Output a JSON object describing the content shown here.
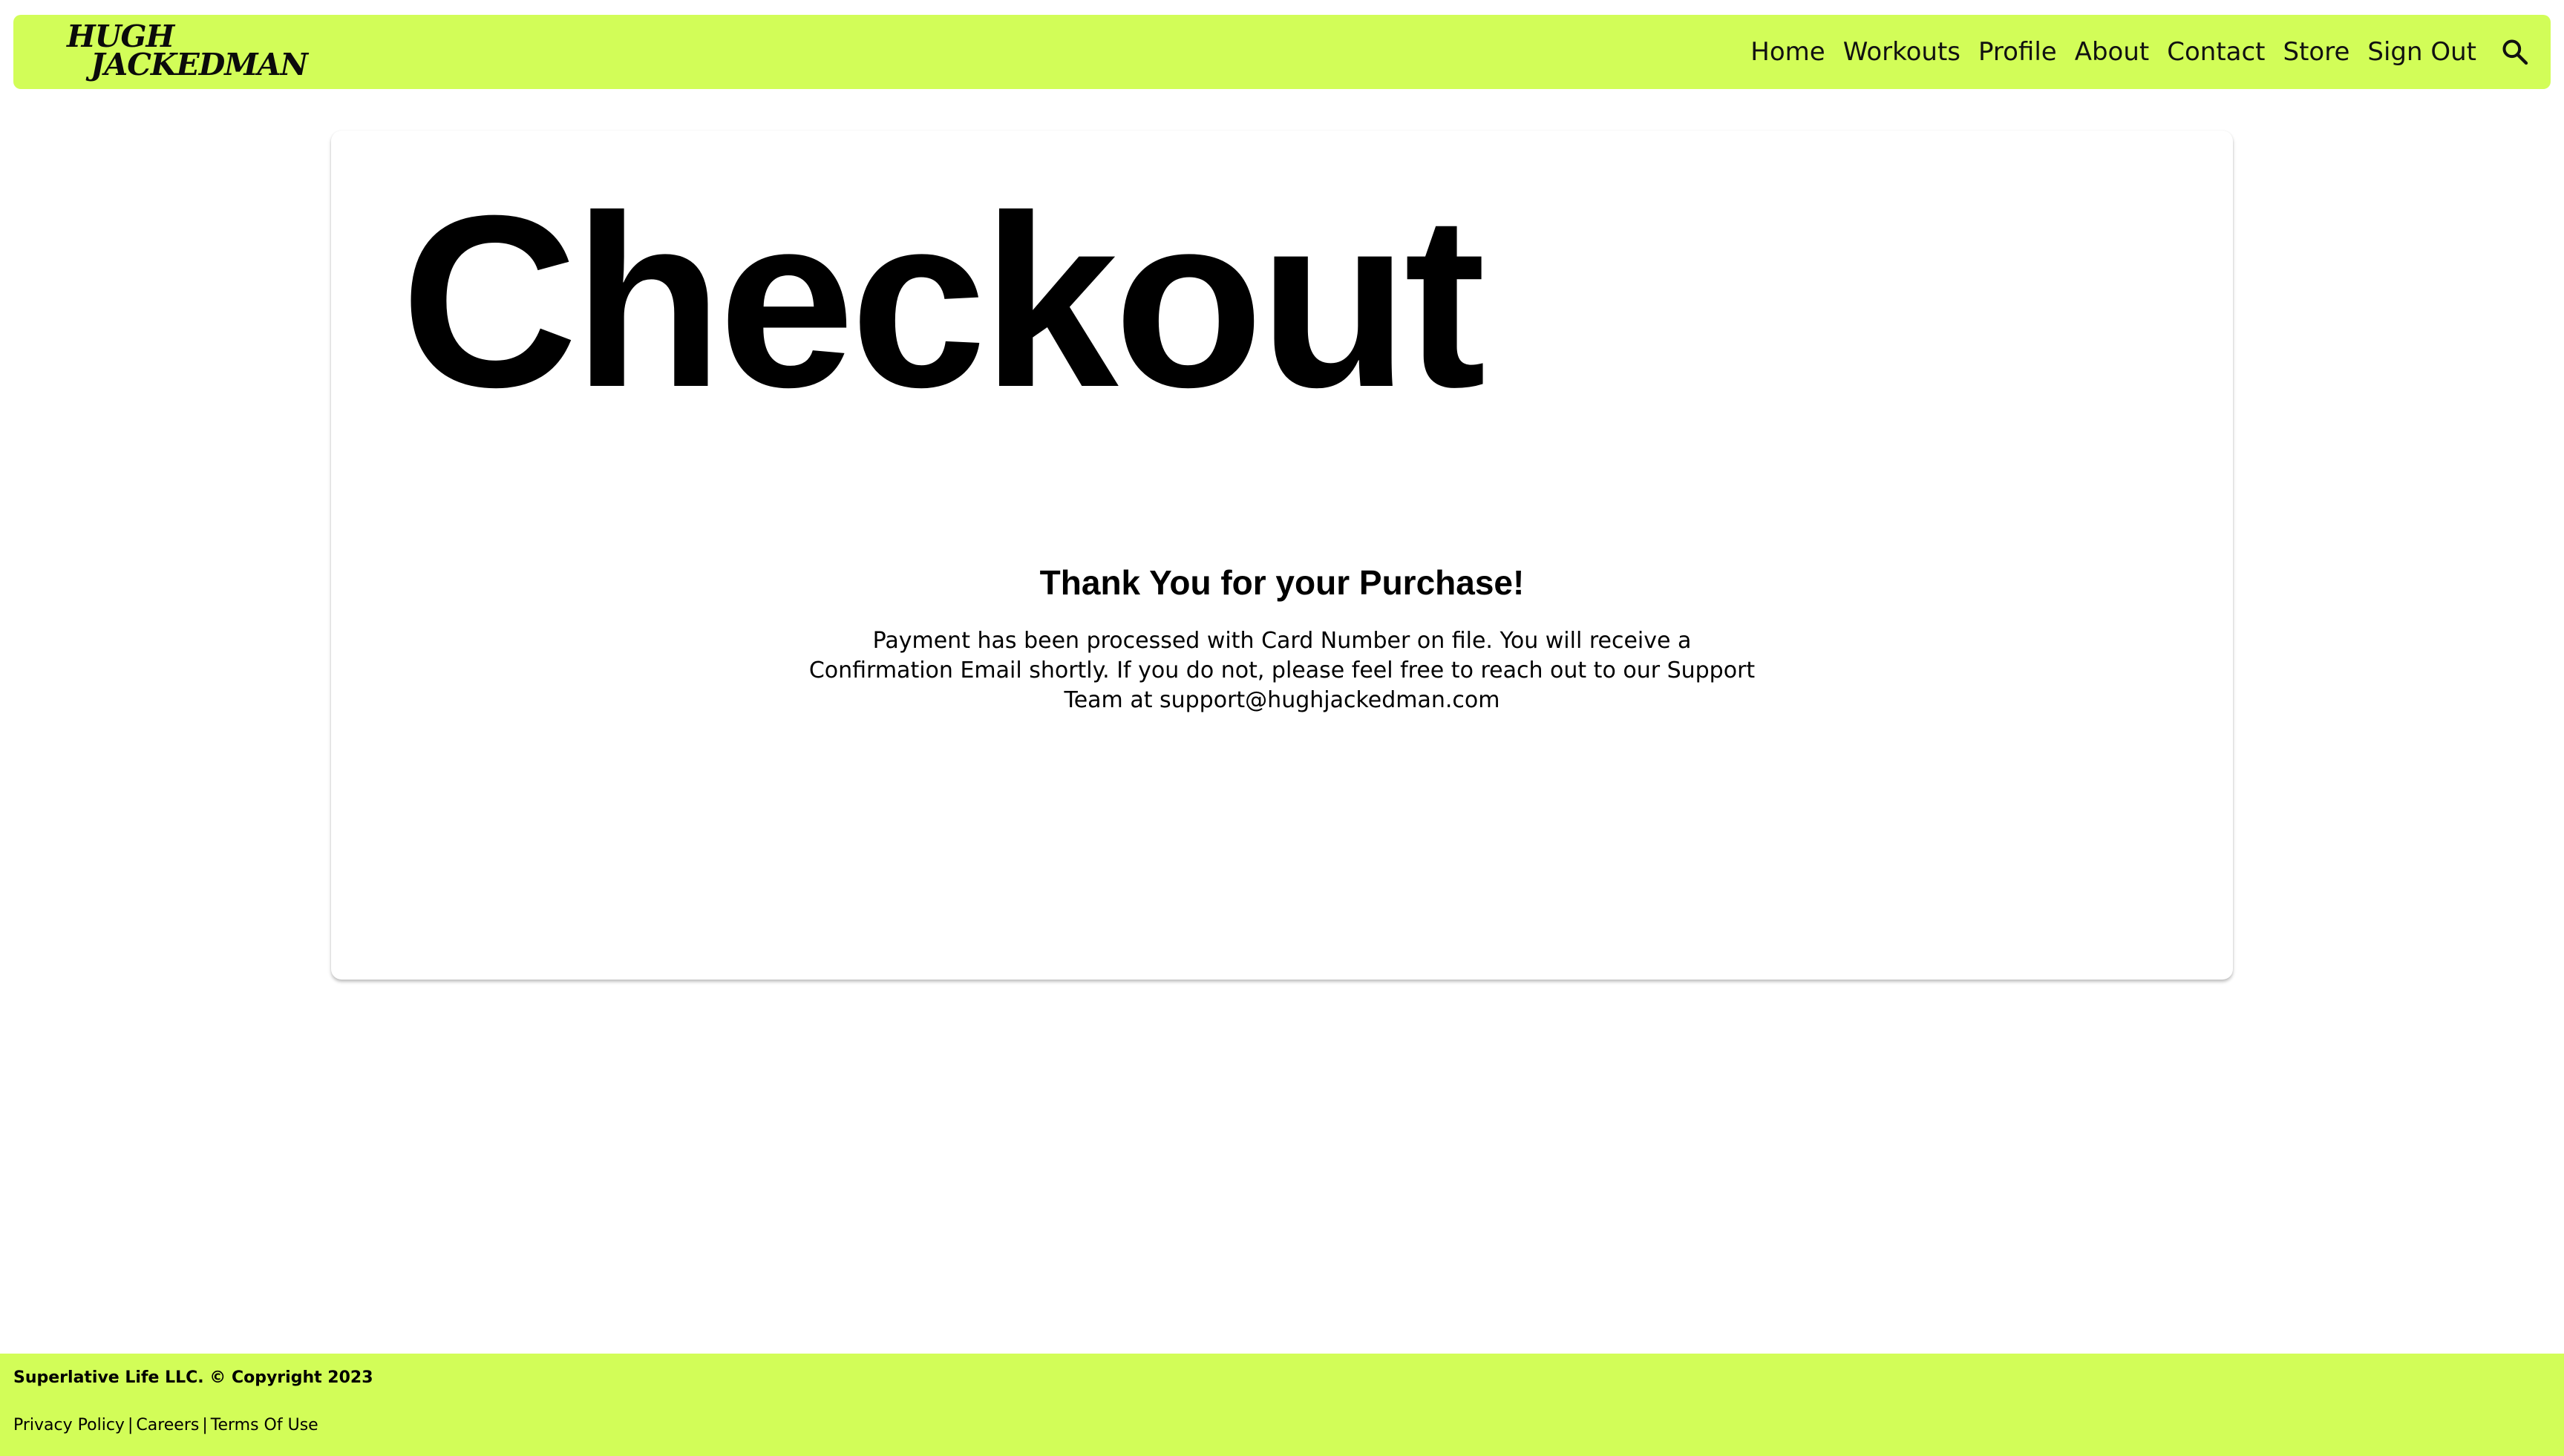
{
  "header": {
    "logo_line1": "HUGH",
    "logo_line2": "JACKEDMAN",
    "nav": {
      "home": "Home",
      "workouts": "Workouts",
      "profile": "Profile",
      "about": "About",
      "contact": "Contact",
      "store": "Store",
      "sign_out": "Sign Out"
    },
    "search_icon": "search-icon"
  },
  "main": {
    "title": "Checkout",
    "thanks_heading": "Thank You for your Purchase!",
    "thanks_message": "Payment has been processed with Card Number on file. You will receive a Confirmation Email shortly. If you do not, please feel free to reach out to our Support Team at support@hughjackedman.com"
  },
  "footer": {
    "copyright": "Superlative Life LLC. © Copyright 2023",
    "links": {
      "privacy": "Privacy Policy",
      "careers": "Careers",
      "terms": "Terms Of Use"
    },
    "separator": "|"
  },
  "colors": {
    "accent": "#d2fd58",
    "text": "#000000",
    "background": "#ffffff"
  }
}
